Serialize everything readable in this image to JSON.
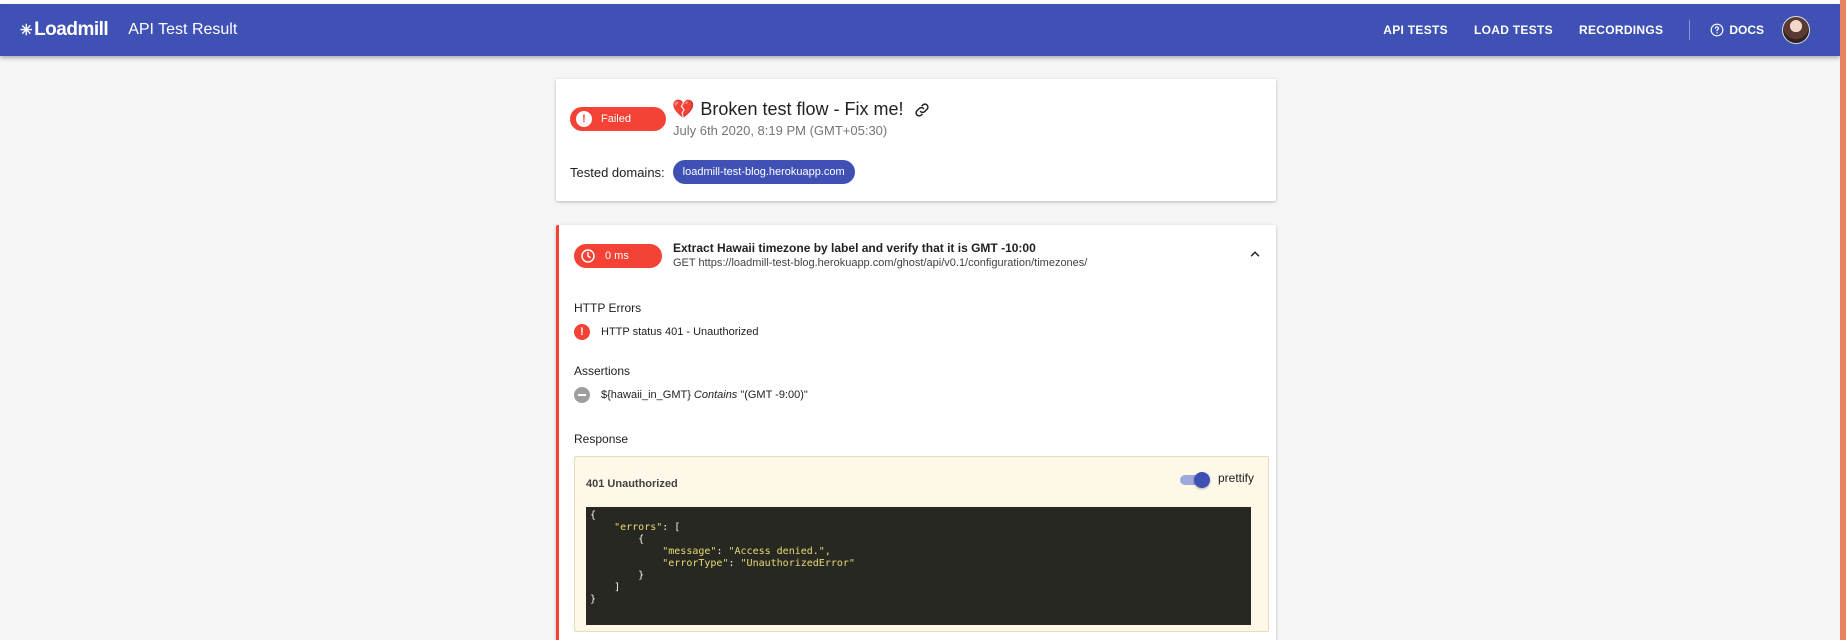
{
  "header": {
    "logo_text": "Loadmill",
    "title": "API Test Result",
    "nav": [
      "API TESTS",
      "LOAD TESTS",
      "RECORDINGS"
    ],
    "docs_label": "DOCS"
  },
  "summary": {
    "status": "Failed",
    "title": "Broken test flow - Fix me!",
    "date": "July 6th 2020, 8:19 PM (GMT+05:30)",
    "domains_label": "Tested domains:",
    "domains": [
      "loadmill-test-blog.herokuapp.com"
    ]
  },
  "request": {
    "duration": "0 ms",
    "title": "Extract Hawaii timezone by label and verify that it is GMT -10:00",
    "url": "GET https://loadmill-test-blog.herokuapp.com/ghost/api/v0.1/configuration/timezones/",
    "http_errors_label": "HTTP Errors",
    "http_error": "HTTP status 401 - Unauthorized",
    "assertions_label": "Assertions",
    "assertion": {
      "variable": "${hawaii_in_GMT}",
      "operator": "Contains",
      "value": "\"(GMT -9:00)\""
    },
    "response_label": "Response",
    "response_status": "401 Unauthorized",
    "prettify_label": "prettify",
    "prettify_on": true,
    "body_lines": [
      {
        "indent": "",
        "text": "{",
        "key": "",
        "value": ""
      },
      {
        "indent": "    ",
        "text": ": [",
        "key": "\"errors\"",
        "value": ""
      },
      {
        "indent": "        ",
        "text": "{",
        "key": "",
        "value": ""
      },
      {
        "indent": "            ",
        "text": ": ",
        "key": "\"message\"",
        "value": "\"Access denied.\","
      },
      {
        "indent": "            ",
        "text": ": ",
        "key": "\"errorType\"",
        "value": "\"UnauthorizedError\""
      },
      {
        "indent": "        ",
        "text": "}",
        "key": "",
        "value": ""
      },
      {
        "indent": "    ",
        "text": "]",
        "key": "",
        "value": ""
      },
      {
        "indent": "",
        "text": "}",
        "key": "",
        "value": ""
      }
    ]
  },
  "colors": {
    "primary": "#3f51b5",
    "error": "#f44336",
    "code_bg": "#272822",
    "code_string": "#e6db74"
  }
}
